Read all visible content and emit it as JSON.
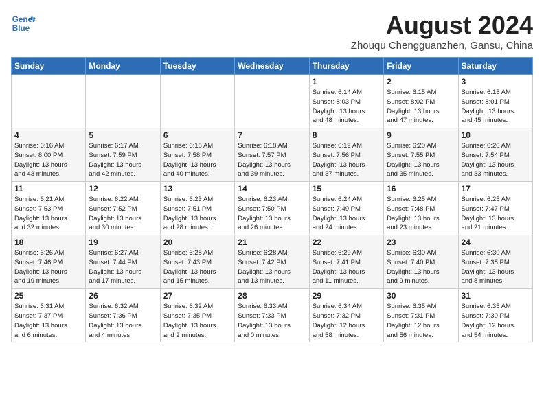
{
  "header": {
    "logo_line1": "General",
    "logo_line2": "Blue",
    "month_title": "August 2024",
    "location": "Zhouqu Chengguanzhen, Gansu, China"
  },
  "weekdays": [
    "Sunday",
    "Monday",
    "Tuesday",
    "Wednesday",
    "Thursday",
    "Friday",
    "Saturday"
  ],
  "weeks": [
    [
      {
        "day": "",
        "detail": ""
      },
      {
        "day": "",
        "detail": ""
      },
      {
        "day": "",
        "detail": ""
      },
      {
        "day": "",
        "detail": ""
      },
      {
        "day": "1",
        "detail": "Sunrise: 6:14 AM\nSunset: 8:03 PM\nDaylight: 13 hours\nand 48 minutes."
      },
      {
        "day": "2",
        "detail": "Sunrise: 6:15 AM\nSunset: 8:02 PM\nDaylight: 13 hours\nand 47 minutes."
      },
      {
        "day": "3",
        "detail": "Sunrise: 6:15 AM\nSunset: 8:01 PM\nDaylight: 13 hours\nand 45 minutes."
      }
    ],
    [
      {
        "day": "4",
        "detail": "Sunrise: 6:16 AM\nSunset: 8:00 PM\nDaylight: 13 hours\nand 43 minutes."
      },
      {
        "day": "5",
        "detail": "Sunrise: 6:17 AM\nSunset: 7:59 PM\nDaylight: 13 hours\nand 42 minutes."
      },
      {
        "day": "6",
        "detail": "Sunrise: 6:18 AM\nSunset: 7:58 PM\nDaylight: 13 hours\nand 40 minutes."
      },
      {
        "day": "7",
        "detail": "Sunrise: 6:18 AM\nSunset: 7:57 PM\nDaylight: 13 hours\nand 39 minutes."
      },
      {
        "day": "8",
        "detail": "Sunrise: 6:19 AM\nSunset: 7:56 PM\nDaylight: 13 hours\nand 37 minutes."
      },
      {
        "day": "9",
        "detail": "Sunrise: 6:20 AM\nSunset: 7:55 PM\nDaylight: 13 hours\nand 35 minutes."
      },
      {
        "day": "10",
        "detail": "Sunrise: 6:20 AM\nSunset: 7:54 PM\nDaylight: 13 hours\nand 33 minutes."
      }
    ],
    [
      {
        "day": "11",
        "detail": "Sunrise: 6:21 AM\nSunset: 7:53 PM\nDaylight: 13 hours\nand 32 minutes."
      },
      {
        "day": "12",
        "detail": "Sunrise: 6:22 AM\nSunset: 7:52 PM\nDaylight: 13 hours\nand 30 minutes."
      },
      {
        "day": "13",
        "detail": "Sunrise: 6:23 AM\nSunset: 7:51 PM\nDaylight: 13 hours\nand 28 minutes."
      },
      {
        "day": "14",
        "detail": "Sunrise: 6:23 AM\nSunset: 7:50 PM\nDaylight: 13 hours\nand 26 minutes."
      },
      {
        "day": "15",
        "detail": "Sunrise: 6:24 AM\nSunset: 7:49 PM\nDaylight: 13 hours\nand 24 minutes."
      },
      {
        "day": "16",
        "detail": "Sunrise: 6:25 AM\nSunset: 7:48 PM\nDaylight: 13 hours\nand 23 minutes."
      },
      {
        "day": "17",
        "detail": "Sunrise: 6:25 AM\nSunset: 7:47 PM\nDaylight: 13 hours\nand 21 minutes."
      }
    ],
    [
      {
        "day": "18",
        "detail": "Sunrise: 6:26 AM\nSunset: 7:46 PM\nDaylight: 13 hours\nand 19 minutes."
      },
      {
        "day": "19",
        "detail": "Sunrise: 6:27 AM\nSunset: 7:44 PM\nDaylight: 13 hours\nand 17 minutes."
      },
      {
        "day": "20",
        "detail": "Sunrise: 6:28 AM\nSunset: 7:43 PM\nDaylight: 13 hours\nand 15 minutes."
      },
      {
        "day": "21",
        "detail": "Sunrise: 6:28 AM\nSunset: 7:42 PM\nDaylight: 13 hours\nand 13 minutes."
      },
      {
        "day": "22",
        "detail": "Sunrise: 6:29 AM\nSunset: 7:41 PM\nDaylight: 13 hours\nand 11 minutes."
      },
      {
        "day": "23",
        "detail": "Sunrise: 6:30 AM\nSunset: 7:40 PM\nDaylight: 13 hours\nand 9 minutes."
      },
      {
        "day": "24",
        "detail": "Sunrise: 6:30 AM\nSunset: 7:38 PM\nDaylight: 13 hours\nand 8 minutes."
      }
    ],
    [
      {
        "day": "25",
        "detail": "Sunrise: 6:31 AM\nSunset: 7:37 PM\nDaylight: 13 hours\nand 6 minutes."
      },
      {
        "day": "26",
        "detail": "Sunrise: 6:32 AM\nSunset: 7:36 PM\nDaylight: 13 hours\nand 4 minutes."
      },
      {
        "day": "27",
        "detail": "Sunrise: 6:32 AM\nSunset: 7:35 PM\nDaylight: 13 hours\nand 2 minutes."
      },
      {
        "day": "28",
        "detail": "Sunrise: 6:33 AM\nSunset: 7:33 PM\nDaylight: 13 hours\nand 0 minutes."
      },
      {
        "day": "29",
        "detail": "Sunrise: 6:34 AM\nSunset: 7:32 PM\nDaylight: 12 hours\nand 58 minutes."
      },
      {
        "day": "30",
        "detail": "Sunrise: 6:35 AM\nSunset: 7:31 PM\nDaylight: 12 hours\nand 56 minutes."
      },
      {
        "day": "31",
        "detail": "Sunrise: 6:35 AM\nSunset: 7:30 PM\nDaylight: 12 hours\nand 54 minutes."
      }
    ]
  ]
}
